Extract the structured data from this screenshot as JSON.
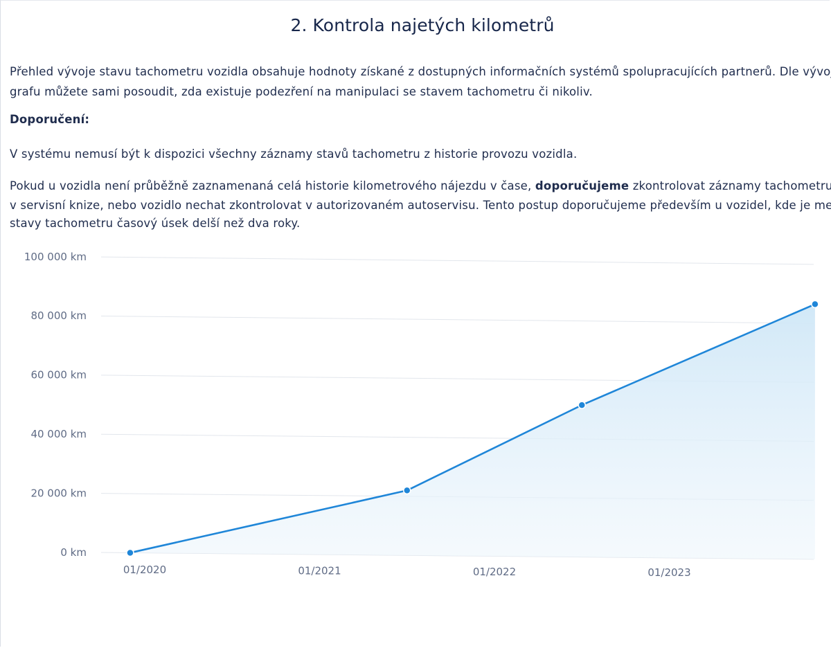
{
  "section": {
    "title": "2. Kontrola najetých kilometrů",
    "intro_line1": "Přehled vývoje stavu tachometru vozidla obsahuje hodnoty získané z dostupných informačních systémů spolupracujících partnerů. Dle vývoje",
    "intro_line2": "grafu můžete sami posoudit, zda existuje podezření na manipulaci se stavem tachometru či nikoliv.",
    "recommendation_label": "Doporučení:",
    "note": "V systému nemusí být k dispozici všechny záznamy stavů tachometru z historie provozu vozidla.",
    "advice_line1_a": "Pokud u vozidla není průběžně zaznamenaná celá historie kilometrového nájezdu v čase, ",
    "advice_line1_bold": "doporučujeme",
    "advice_line1_b": " zkontrolovat záznamy tachometru také",
    "advice_line2": "v servisní knize, nebo vozidlo nechat zkontrolovat v autorizovaném autoservisu. Tento postup doporučujeme především u vozidel, kde je mezi",
    "advice_line3": "stavy tachometru časový úsek delší než dva roky."
  },
  "chart_data": {
    "type": "area",
    "title": "",
    "xlabel": "",
    "ylabel": "",
    "x_ticks": [
      "01/2020",
      "01/2021",
      "01/2022",
      "01/2023"
    ],
    "y_ticks": [
      "0 km",
      "20 000 km",
      "40 000 km",
      "60 000 km",
      "80 000 km",
      "100 000 km"
    ],
    "ylim": [
      0,
      100000
    ],
    "grid": true,
    "series": [
      {
        "x": [
          "2019-12",
          "2021-07",
          "2022-07",
          "2023-11"
        ],
        "values": [
          0,
          22000,
          51500,
          86500
        ]
      }
    ],
    "colors": {
      "line": "#1f86d8",
      "fill": "#d6ebf8"
    }
  }
}
